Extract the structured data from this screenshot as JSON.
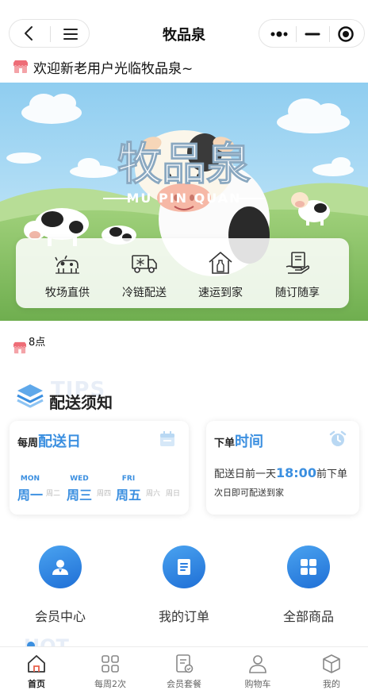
{
  "navbar": {
    "title": "牧品泉"
  },
  "welcome": {
    "text": "欢迎新老用户光临牧品泉~"
  },
  "banner": {
    "logo_text": "牧品泉",
    "logo_sub": "— MU PIN QUAN —"
  },
  "features": [
    {
      "label": "牧场直供",
      "icon": "cow-icon"
    },
    {
      "label": "冷链配送",
      "icon": "cold-truck-icon"
    },
    {
      "label": "速运到家",
      "icon": "home-bottle-icon"
    },
    {
      "label": "随订随享",
      "icon": "hand-box-icon"
    }
  ],
  "hours": {
    "text": "8点"
  },
  "delivery_section": {
    "title": "配送须知",
    "bg_text": "TIPS"
  },
  "weekly_card": {
    "title_small": "每周",
    "title_big": "配送日",
    "days": [
      {
        "en": "MON",
        "cn": "周一",
        "active": true
      },
      {
        "en": "",
        "cn": "周二",
        "active": false
      },
      {
        "en": "WED",
        "cn": "周三",
        "active": true
      },
      {
        "en": "",
        "cn": "周四",
        "active": false
      },
      {
        "en": "FRI",
        "cn": "周五",
        "active": true
      },
      {
        "en": "",
        "cn": "周六",
        "active": false
      },
      {
        "en": "",
        "cn": "周日",
        "active": false
      }
    ]
  },
  "order_card": {
    "title_small": "下单",
    "title_big": "时间",
    "line1_prefix": "配送日前一天",
    "line1_time": "18:00",
    "line1_suffix": "前下单",
    "line2": "次日即可配送到家"
  },
  "quick_actions": [
    {
      "label": "会员中心",
      "icon": "member-icon"
    },
    {
      "label": "我的订单",
      "icon": "order-icon"
    },
    {
      "label": "全部商品",
      "icon": "grid-icon"
    }
  ],
  "hot_section": {
    "bg_text": "HOT"
  },
  "tabbar": [
    {
      "label": "首页",
      "icon": "home-icon",
      "active": true
    },
    {
      "label": "每周2次",
      "icon": "apps-icon",
      "active": false
    },
    {
      "label": "会员套餐",
      "icon": "package-icon",
      "active": false
    },
    {
      "label": "购物车",
      "icon": "user-icon",
      "active": false
    },
    {
      "label": "我的",
      "icon": "box-icon",
      "active": false
    }
  ],
  "colors": {
    "accent": "#3b8fe0",
    "banner_sky": "#9fd4f2",
    "grass": "#8cc06a"
  }
}
